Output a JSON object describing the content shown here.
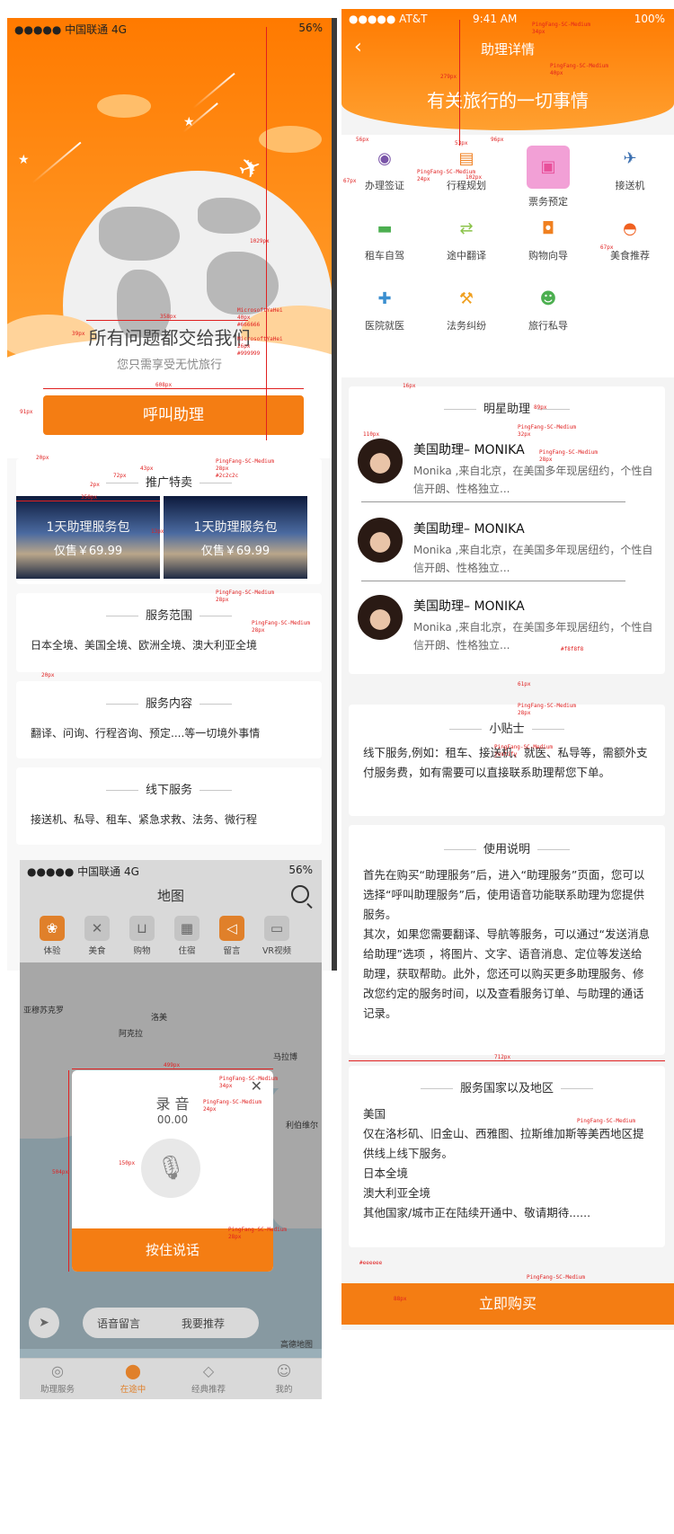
{
  "panel1": {
    "status": {
      "carrier": "●●●●● 中国联通  4G",
      "battery": "56%"
    },
    "hero_title": "所有问题都交给我们",
    "hero_subtitle": "您只需享受无忧旅行",
    "call_button": "呼叫助理",
    "promo": {
      "heading": "推广特卖",
      "items": [
        {
          "title": "1天助理服务包",
          "price": "仅售￥69.99"
        },
        {
          "title": "1天助理服务包",
          "price": "仅售￥69.99"
        }
      ]
    },
    "scope": {
      "heading": "服务范围",
      "text": "日本全境、美国全境、欧洲全境、澳大利亚全境"
    },
    "content": {
      "heading": "服务内容",
      "text": "翻译、问询、行程咨询、预定....等一切境外事情"
    },
    "offline": {
      "heading": "线下服务",
      "text": "接送机、私导、租车、紧急求救、法务、微行程"
    }
  },
  "panel2": {
    "status": {
      "carrier": "●●●●● AT&T",
      "time": "9:41 AM",
      "battery": "100%"
    },
    "nav_title": "助理详情",
    "hero": "有关旅行的一切事情",
    "services": [
      {
        "label": "办理签证",
        "icon": "globe-icon",
        "color": "#7a54a8"
      },
      {
        "label": "行程规划",
        "icon": "calendar-icon",
        "color": "#f08020"
      },
      {
        "label": "票务预定",
        "icon": "ticket-icon",
        "color": "#e8509a"
      },
      {
        "label": "接送机",
        "icon": "plane-icon",
        "color": "#3b6fb0"
      },
      {
        "label": "租车自驾",
        "icon": "car-icon",
        "color": "#4caf50"
      },
      {
        "label": "途中翻译",
        "icon": "translate-icon",
        "color": "#8bc34a"
      },
      {
        "label": "购物向导",
        "icon": "shopping-bag-icon",
        "color": "#f08020"
      },
      {
        "label": "美食推荐",
        "icon": "food-icon",
        "color": "#f06020"
      },
      {
        "label": "医院就医",
        "icon": "medical-icon",
        "color": "#3b8fd0"
      },
      {
        "label": "法务纠纷",
        "icon": "gavel-icon",
        "color": "#f0a020"
      },
      {
        "label": "旅行私导",
        "icon": "guide-icon",
        "color": "#4caf50"
      }
    ],
    "stars": {
      "heading": "明星助理",
      "items": [
        {
          "name": "美国助理– MONIKA",
          "desc": "Monika ,来自北京，在美国多年现居纽约，个性自信开朗、性格独立..."
        },
        {
          "name": "美国助理– MONIKA",
          "desc": "Monika ,来自北京，在美国多年现居纽约，个性自信开朗、性格独立..."
        },
        {
          "name": "美国助理– MONIKA",
          "desc": "Monika ,来自北京，在美国多年现居纽约，个性自信开朗、性格独立..."
        }
      ]
    },
    "tips": {
      "heading": "小贴士",
      "text": "线下服务,例如：租车、接送机、就医、私导等，需额外支付服务费，如有需要可以直接联系助理帮您下单。"
    },
    "usage": {
      "heading": "使用说明",
      "paragraphs": [
        "首先在购买“助理服务”后，进入“助理服务”页面，您可以选择“呼叫助理服务”后，使用语音功能联系助理为您提供服务。",
        "其次，如果您需要翻译、导航等服务，可以通过“发送消息给助理”选项 ，将图片、文字、语音消息、定位等发送给助理，获取帮助。此外，您还可以购买更多助理服务、修改您约定的服务时间，以及查看服务订单、与助理的通话记录。"
      ]
    },
    "countries": {
      "heading": "服务国家以及地区",
      "lines": [
        "美国",
        "仅在洛杉矶、旧金山、西雅图、拉斯维加斯等美西地区提供线上线下服务。",
        "日本全境",
        "澳大利亚全境",
        "其他国家/城市正在陆续开通中、敬请期待......"
      ]
    },
    "buy_button": "立即购买"
  },
  "panel3": {
    "status": {
      "carrier": "●●●●● 中国联通  4G",
      "battery": "56%"
    },
    "title": "地图",
    "categories": [
      {
        "label": "体验",
        "icon": "experience-icon",
        "active": true
      },
      {
        "label": "美食",
        "icon": "utensils-icon",
        "active": false
      },
      {
        "label": "购物",
        "icon": "cart-icon",
        "active": false
      },
      {
        "label": "住宿",
        "icon": "building-icon",
        "active": false
      },
      {
        "label": "留言",
        "icon": "speaker-icon",
        "active": true
      },
      {
        "label": "VR视频",
        "icon": "video-icon",
        "active": false
      }
    ],
    "places": [
      "亚穆苏克罗",
      "洛美",
      "阿克拉",
      "马拉博",
      "利伯维尔"
    ],
    "dialog": {
      "title": "录 音",
      "time": "00.00",
      "press_button": "按住说话"
    },
    "voice_message": "语音留言",
    "recommend": "我要推荐",
    "tabs": [
      {
        "label": "助理服务",
        "icon": "assistant-icon",
        "active": false
      },
      {
        "label": "在途中",
        "icon": "location-pin-icon",
        "active": true
      },
      {
        "label": "经典推荐",
        "icon": "diamond-icon",
        "active": false
      },
      {
        "label": "我的",
        "icon": "user-icon",
        "active": false
      }
    ],
    "map_brand": "高德地图"
  },
  "annotations": {
    "font_pingfang": "PingFang-SC-Medium",
    "font_yahei": "MicrosoftYaHei",
    "color_2c": "#2c2c2c",
    "color_66": "#666666",
    "color_99": "#999999",
    "color_f8": "#f8f8f8",
    "color_ee": "#eeeeee",
    "size_28": "28px",
    "size_34": "34px",
    "size_26": "26px",
    "size_40": "40px",
    "size_24": "24px",
    "size_32": "32px",
    "left": "left",
    "justify": "justify",
    "dims": {
      "d1029": "1029px",
      "d358": "358px",
      "d39": "39px",
      "d608": "608px",
      "d91": "91px",
      "d20": "20px",
      "d72": "72px",
      "d2": "2px",
      "d43": "43px",
      "d350": "350px",
      "d13": "13px",
      "d279": "279px",
      "d53": "53px",
      "d56": "56px",
      "d96": "96px",
      "d102": "102px",
      "d67": "67px",
      "d16": "16px",
      "d89": "89px",
      "d110": "110px",
      "d61": "61px",
      "d712": "712px",
      "d499": "499px",
      "d150": "150px",
      "d504": "504px",
      "d88": "88px"
    }
  }
}
